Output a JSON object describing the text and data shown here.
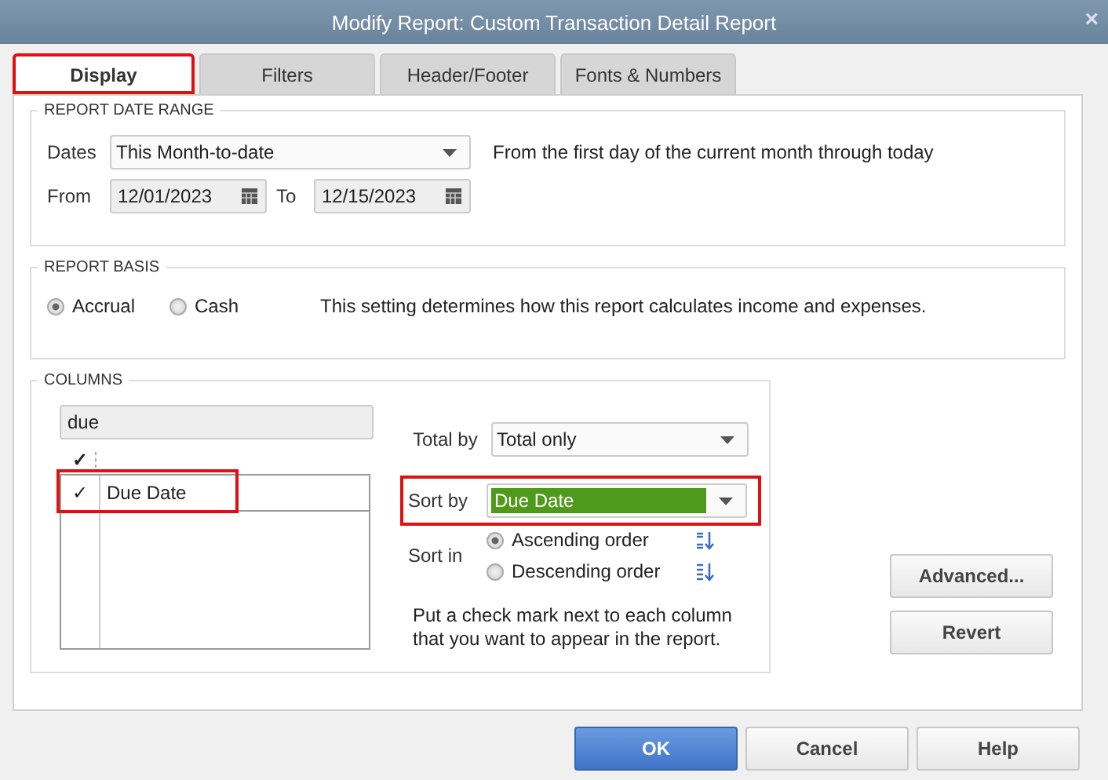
{
  "window": {
    "title": "Modify Report: Custom Transaction Detail Report",
    "close": "×"
  },
  "tabs": [
    {
      "label": "Display",
      "selected": true,
      "highlighted": true
    },
    {
      "label": "Filters",
      "selected": false,
      "highlighted": false
    },
    {
      "label": "Header/Footer",
      "selected": false,
      "highlighted": false
    },
    {
      "label": "Fonts & Numbers",
      "selected": false,
      "highlighted": false
    }
  ],
  "date_range": {
    "heading": "REPORT DATE RANGE",
    "dates_label": "Dates",
    "dates_value": "This Month-to-date",
    "description": "From the first day of the current month through today",
    "from_label": "From",
    "from_value": "12/01/2023",
    "to_label": "To",
    "to_value": "12/15/2023"
  },
  "report_basis": {
    "heading": "REPORT BASIS",
    "options": [
      {
        "label": "Accrual",
        "selected": true
      },
      {
        "label": "Cash",
        "selected": false
      }
    ],
    "description": "This setting determines how this report calculates income and expenses."
  },
  "columns": {
    "heading": "COLUMNS",
    "search_value": "due",
    "check_header": "✓",
    "items": [
      {
        "label": "Due Date",
        "check": "✓",
        "checked": true,
        "highlighted": true
      }
    ],
    "total_by_label": "Total by",
    "total_by_value": "Total only",
    "sort_by_label": "Sort by",
    "sort_by_value": "Due Date",
    "sort_by_highlighted": true,
    "sort_in_label": "Sort in",
    "sort_options": [
      {
        "label": "Ascending order",
        "selected": true,
        "kind": "ascending"
      },
      {
        "label": "Descending order",
        "selected": false,
        "kind": "descending"
      }
    ],
    "hint": "Put a check mark next to each column that you want to appear in the report."
  },
  "side_buttons": [
    "Advanced...",
    "Revert"
  ],
  "buttons": [
    {
      "label": "OK",
      "kind": "primary"
    },
    {
      "label": "Cancel",
      "kind": "normal"
    },
    {
      "label": "Help",
      "kind": "normal"
    }
  ]
}
